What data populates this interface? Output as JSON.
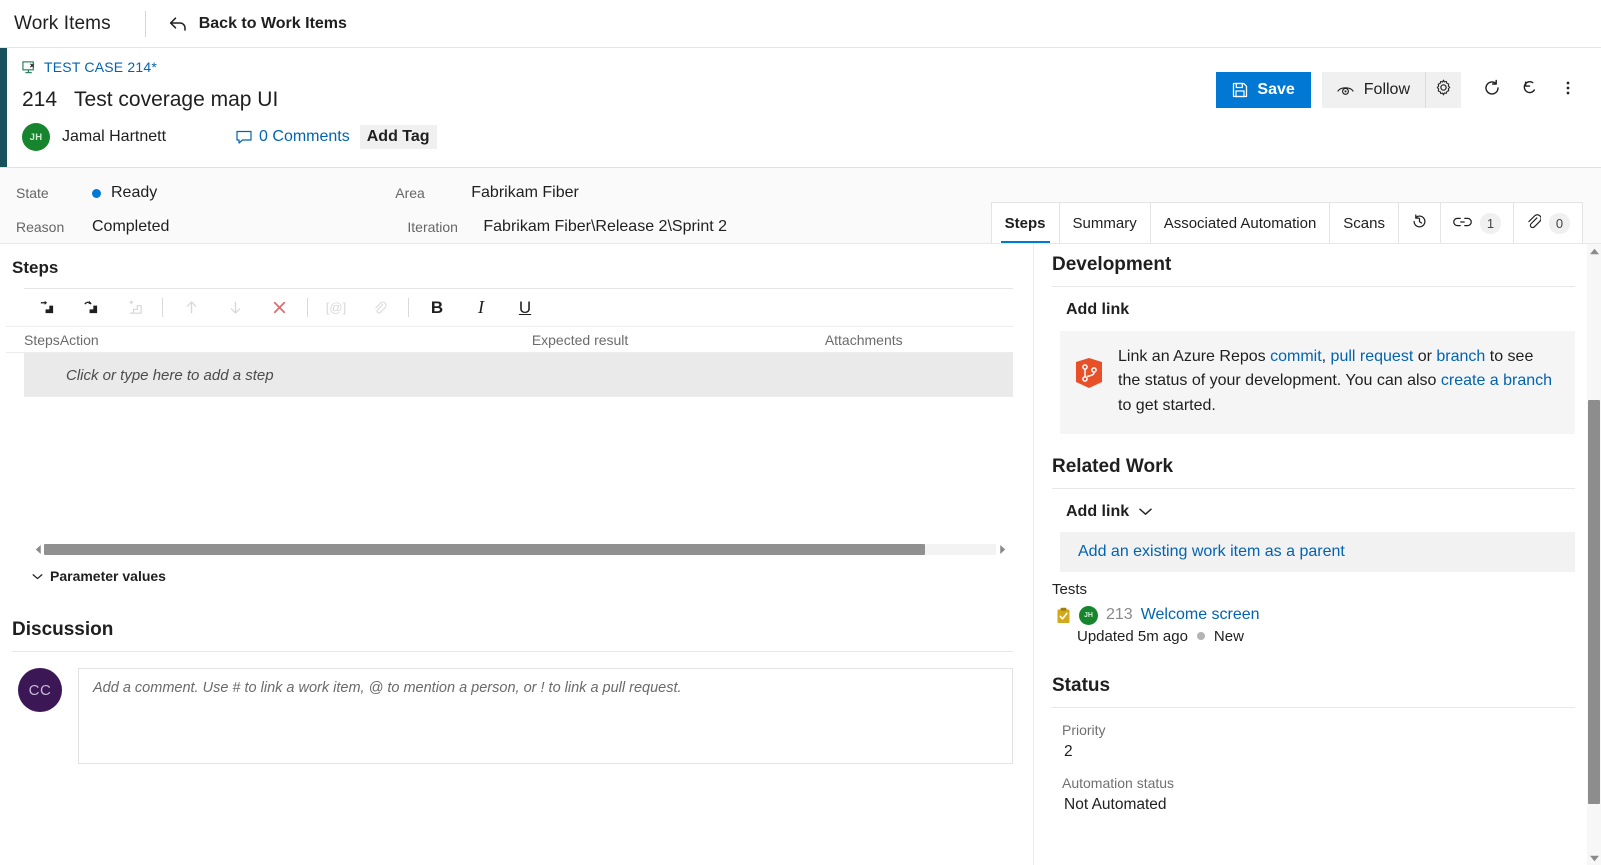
{
  "topnav": {
    "title": "Work Items",
    "back_label": "Back to Work Items",
    "back_icon": "back-arrow-icon"
  },
  "work_item": {
    "type_label": "TEST CASE 214*",
    "type_icon": "test-case-icon",
    "id": "214",
    "title": "Test coverage map UI",
    "assignee": "Jamal Hartnett",
    "assignee_initials": "JH",
    "comments_label": "0 Comments",
    "comments_icon": "speech-bubble-icon",
    "add_tag_label": "Add Tag",
    "accent_color": "#17525c"
  },
  "toolbar": {
    "save_label": "Save",
    "save_icon": "save-disk-icon",
    "follow_label": "Follow",
    "follow_icon": "eye-icon",
    "settings_icon": "gear-icon",
    "refresh_icon": "refresh-icon",
    "revert_icon": "undo-icon",
    "more_icon": "more-vertical-icon",
    "accent_color": "#0078d4"
  },
  "fields": {
    "state_label": "State",
    "state_value": "Ready",
    "state_color": "#0078d4",
    "reason_label": "Reason",
    "reason_value": "Completed",
    "area_label": "Area",
    "area_value": "Fabrikam Fiber",
    "iteration_label": "Iteration",
    "iteration_value": "Fabrikam Fiber\\Release 2\\Sprint 2"
  },
  "tabs": [
    {
      "label": "Steps",
      "active": true
    },
    {
      "label": "Summary",
      "active": false
    },
    {
      "label": "Associated Automation",
      "active": false
    },
    {
      "label": "Scans",
      "active": false
    }
  ],
  "icon_tabs": [
    {
      "icon": "history-icon",
      "count": null
    },
    {
      "icon": "link-icon",
      "count": "1"
    },
    {
      "icon": "paperclip-icon",
      "count": "0"
    }
  ],
  "steps": {
    "section_title": "Steps",
    "toolbar_buttons": [
      {
        "name": "insert-step-icon",
        "disabled": false
      },
      {
        "name": "insert-shared-step-icon",
        "disabled": false
      },
      {
        "name": "insert-step-parameter-icon",
        "disabled": true
      },
      {
        "name": "move-up-icon",
        "disabled": true
      },
      {
        "name": "move-down-icon",
        "disabled": true
      },
      {
        "name": "delete-icon",
        "disabled": false
      },
      {
        "name": "insert-parameter-icon",
        "disabled": true
      },
      {
        "name": "attach-icon",
        "disabled": true
      },
      {
        "name": "bold-icon",
        "disabled": false
      },
      {
        "name": "italic-icon",
        "disabled": false
      },
      {
        "name": "underline-icon",
        "disabled": false
      }
    ],
    "columns": {
      "steps": "Steps",
      "action": "Action",
      "expected": "Expected result",
      "attachments": "Attachments"
    },
    "placeholder_row": "Click or type here to add a step",
    "parameter_values_label": "Parameter values"
  },
  "discussion": {
    "title": "Discussion",
    "avatar_initials": "CC",
    "comment_placeholder": "Add a comment. Use # to link a work item, @ to mention a person, or ! to link a pull request."
  },
  "development": {
    "title": "Development",
    "add_link_label": "Add link",
    "icon": "azure-repos-icon",
    "text_1": "Link an Azure Repos ",
    "link_commit": "commit",
    "text_2": ", ",
    "link_pull_request": "pull request",
    "text_3": " or ",
    "link_branch": "branch",
    "text_4": " to see the status of your development. You can also ",
    "link_create_branch": "create a branch",
    "text_5": " to get started."
  },
  "related_work": {
    "title": "Related Work",
    "add_link_label": "Add link",
    "add_link_icon": "chevron-down-icon",
    "parent_banner": "Add an existing work item as a parent",
    "group_label": "Tests",
    "items": [
      {
        "icon": "test-case-clipboard-icon",
        "avatar_initials": "JH",
        "id": "213",
        "name": "Welcome screen",
        "updated": "Updated 5m ago",
        "state": "New",
        "state_color": "#b4b4b4"
      }
    ]
  },
  "status": {
    "title": "Status",
    "fields": [
      {
        "label": "Priority",
        "value": "2"
      },
      {
        "label": "Automation status",
        "value": "Not Automated"
      }
    ]
  }
}
